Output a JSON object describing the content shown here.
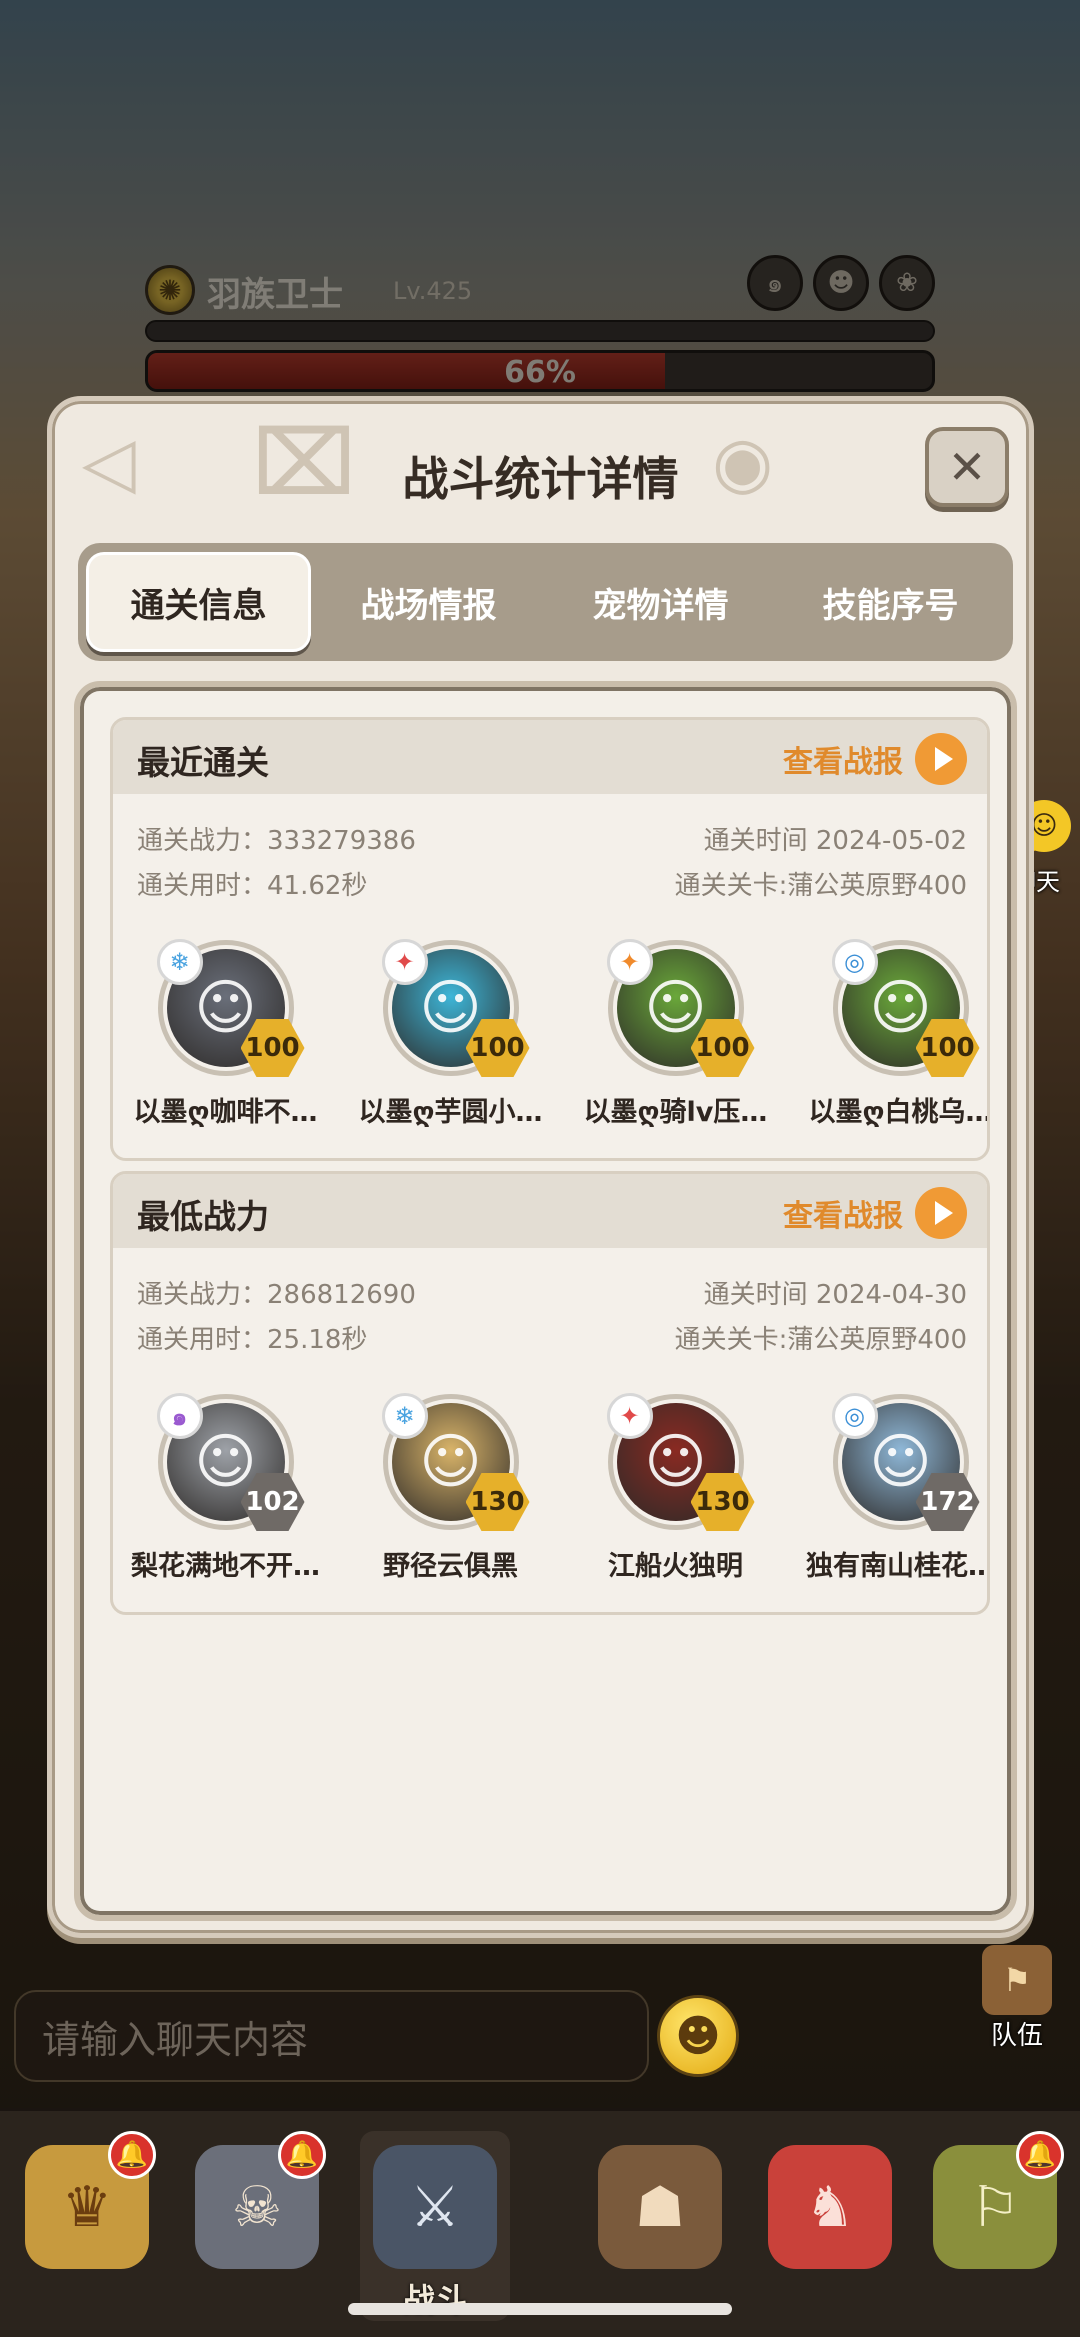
{
  "boss": {
    "name": "羽族卫士",
    "level": "Lv.425",
    "hp_percent_text": "66%",
    "hp_fraction": 0.66
  },
  "dialog": {
    "title": "战斗统计详情",
    "close_label": "✕"
  },
  "tabs": [
    {
      "label": "通关信息",
      "active": true
    },
    {
      "label": "战场情报",
      "active": false
    },
    {
      "label": "宠物详情",
      "active": false
    },
    {
      "label": "技能序号",
      "active": false
    }
  ],
  "cards": [
    {
      "title": "最近通关",
      "view_label": "查看战报",
      "power": "通关战力：333279386",
      "time": "通关时间  2024-05-02",
      "duration": "通关用时：41.62秒",
      "stage": "通关关卡:蒲公英原野400",
      "players": [
        {
          "name": "以墨ღ咖啡不…",
          "level": "100",
          "badge": "gold",
          "element": "ice-icon",
          "element_glyph": "❄",
          "element_color": "#4aa3e0",
          "face_color": "#6a6f7a"
        },
        {
          "name": "以墨ღ芋圆小…",
          "level": "100",
          "badge": "gold",
          "element": "fire-icon",
          "element_glyph": "✦",
          "element_color": "#e04a4a",
          "face_color": "#3db6d8"
        },
        {
          "name": "以墨ღ骑lv压…",
          "level": "100",
          "badge": "gold",
          "element": "fire-icon",
          "element_glyph": "✦",
          "element_color": "#f08a2c",
          "face_color": "#6aa83a"
        },
        {
          "name": "以墨ღ白桃乌…",
          "level": "100",
          "badge": "gold",
          "element": "water-icon",
          "element_glyph": "◎",
          "element_color": "#3b8fd6",
          "face_color": "#6aa83a"
        }
      ]
    },
    {
      "title": "最低战力",
      "view_label": "查看战报",
      "power": "通关战力：286812690",
      "time": "通关时间  2024-04-30",
      "duration": "通关用时：25.18秒",
      "stage": "通关关卡:蒲公英原野400",
      "players": [
        {
          "name": "梨花满地不开…",
          "level": "102",
          "badge": "gray",
          "element": "wind-icon",
          "element_glyph": "๑",
          "element_color": "#9a5ad0",
          "face_color": "#9ea2a8"
        },
        {
          "name": "野径云俱黑",
          "level": "130",
          "badge": "gold",
          "element": "ice-icon",
          "element_glyph": "❄",
          "element_color": "#4aa3e0",
          "face_color": "#d9b469"
        },
        {
          "name": "江船火独明",
          "level": "130",
          "badge": "gold",
          "element": "fire-icon",
          "element_glyph": "✦",
          "element_color": "#e04a4a",
          "face_color": "#8a2a22"
        },
        {
          "name": "独有南山桂花…",
          "level": "172",
          "badge": "gray",
          "element": "water-icon",
          "element_glyph": "◎",
          "element_color": "#3b8fd6",
          "face_color": "#8fb8d8"
        }
      ]
    }
  ],
  "side": {
    "chat_label": "聊天",
    "team_label": "队伍"
  },
  "chat": {
    "placeholder": "请输入聊天内容"
  },
  "bottom_nav": [
    {
      "label": "",
      "icon": "hero-icon",
      "badge": true
    },
    {
      "label": "",
      "icon": "pet-icon",
      "badge": true
    },
    {
      "label": "战斗",
      "icon": "battle-icon",
      "badge": false,
      "active": true
    },
    {
      "label": "",
      "icon": "shop-icon",
      "badge": false
    },
    {
      "label": "",
      "icon": "dragon-icon",
      "badge": false
    },
    {
      "label": "",
      "icon": "guild-icon",
      "badge": true
    }
  ]
}
